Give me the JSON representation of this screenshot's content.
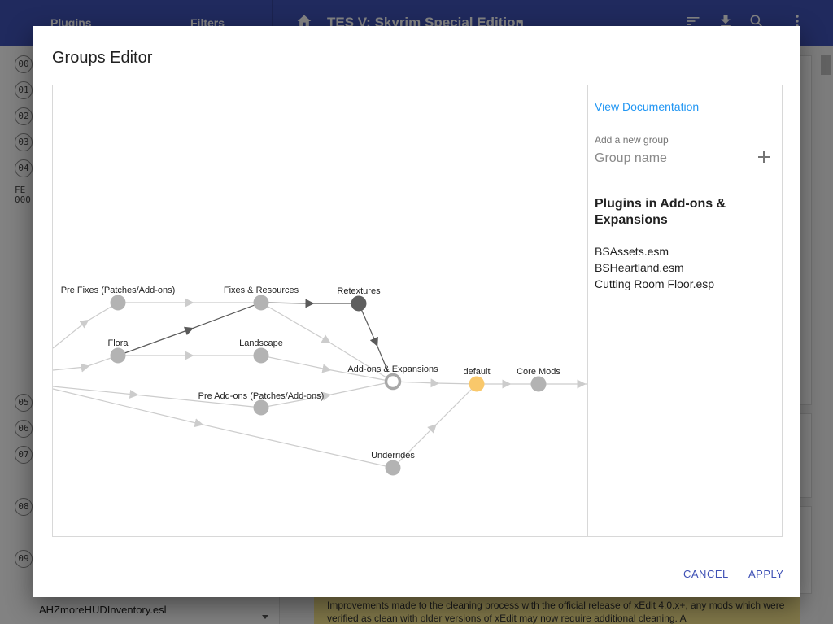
{
  "background": {
    "tabs": [
      "Plugins",
      "Filters"
    ],
    "game_title": "TES V: Skyrim Special Edition",
    "indexes": [
      "00",
      "01",
      "02",
      "03",
      "04",
      "05",
      "06",
      "07",
      "08",
      "09"
    ],
    "fe_label": [
      "FE",
      "000"
    ],
    "bottom_plugin": "AHZmoreHUDInventory.esl",
    "warning_text": "Improvements made to the cleaning process with the official release of xEdit 4.0.x+, any mods which were verified as clean with older versions of xEdit may now require additional cleaning. A",
    "icons": [
      "home-icon",
      "dropdown-caret-icon",
      "sort-icon",
      "download-icon",
      "search-icon",
      "more-vert-icon"
    ]
  },
  "dialog": {
    "title": "Groups Editor",
    "doc_link": "View Documentation",
    "add_group_label": "Add a new group",
    "group_name_placeholder": "Group name",
    "group_name_value": "",
    "plugins_heading": "Plugins in Add-ons & Expansions",
    "plugins": [
      "BSAssets.esm",
      "BSHeartland.esm",
      "Cutting Room Floor.esp"
    ],
    "cancel_label": "CANCEL",
    "apply_label": "APPLY"
  },
  "graph": {
    "nodes": [
      {
        "id": "prefixes",
        "label": "Pre Fixes (Patches/Add-ons)",
        "state": "normal"
      },
      {
        "id": "fixes",
        "label": "Fixes & Resources",
        "state": "normal"
      },
      {
        "id": "retextures",
        "label": "Retextures",
        "state": "dark"
      },
      {
        "id": "flora",
        "label": "Flora",
        "state": "normal"
      },
      {
        "id": "landscape",
        "label": "Landscape",
        "state": "normal"
      },
      {
        "id": "addons",
        "label": "Add-ons & Expansions",
        "state": "selected"
      },
      {
        "id": "preaddons",
        "label": "Pre Add-ons (Patches/Add-ons)",
        "state": "normal"
      },
      {
        "id": "default",
        "label": "default",
        "state": "default"
      },
      {
        "id": "coremods",
        "label": "Core Mods",
        "state": "normal"
      },
      {
        "id": "underrides",
        "label": "Underrides",
        "state": "normal"
      }
    ],
    "colors": {
      "node": "#b3b3b3",
      "dark": "#5f5f5f",
      "default": "#f9c86b",
      "edge": "#cccccc",
      "edge_dark": "#5a5a5a"
    }
  }
}
